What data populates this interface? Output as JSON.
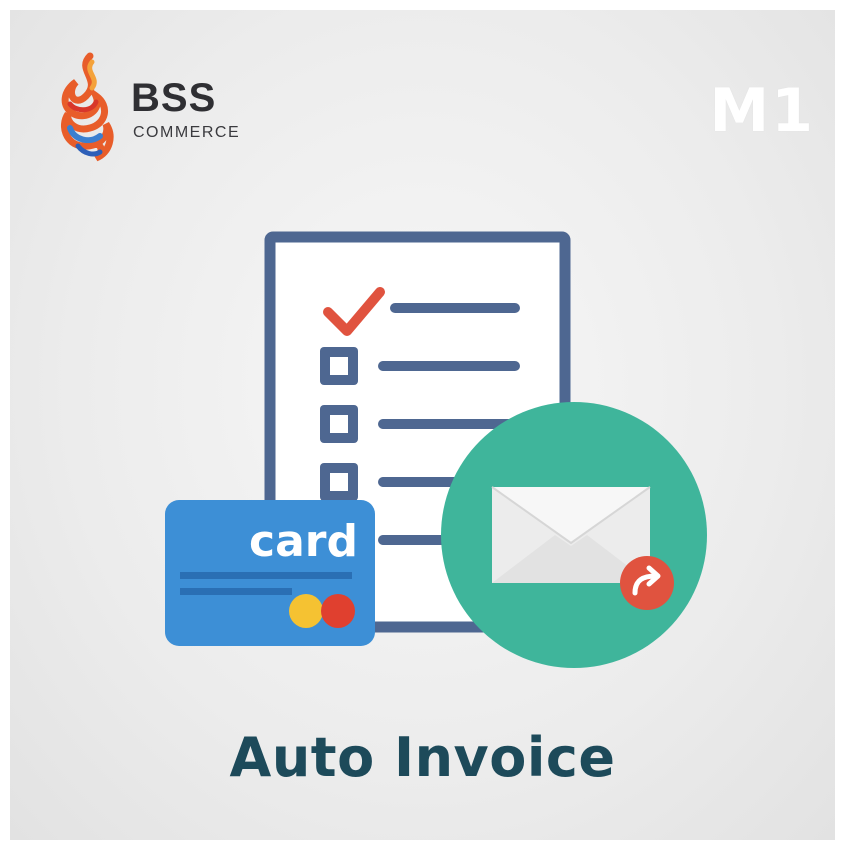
{
  "brand": {
    "name": "BSS",
    "subtitle": "COMMERCE",
    "logo_icon": "flame-swirl-logo"
  },
  "badge": {
    "version": "M1"
  },
  "illustration": {
    "card_label": "card",
    "icons": [
      "checklist-document-icon",
      "check-mark-icon",
      "checkbox-icon",
      "credit-card-icon",
      "envelope-icon",
      "forward-arrow-icon"
    ],
    "colors": {
      "document_stroke": "#4e6791",
      "check": "#e0533f",
      "card": "#3d8fd6",
      "circle": "#3fb59b",
      "envelope": "#ececec",
      "arrow_badge": "#e0533f",
      "coin_yellow": "#f5c232",
      "coin_red": "#e0402f"
    }
  },
  "product": {
    "title": "Auto Invoice"
  }
}
